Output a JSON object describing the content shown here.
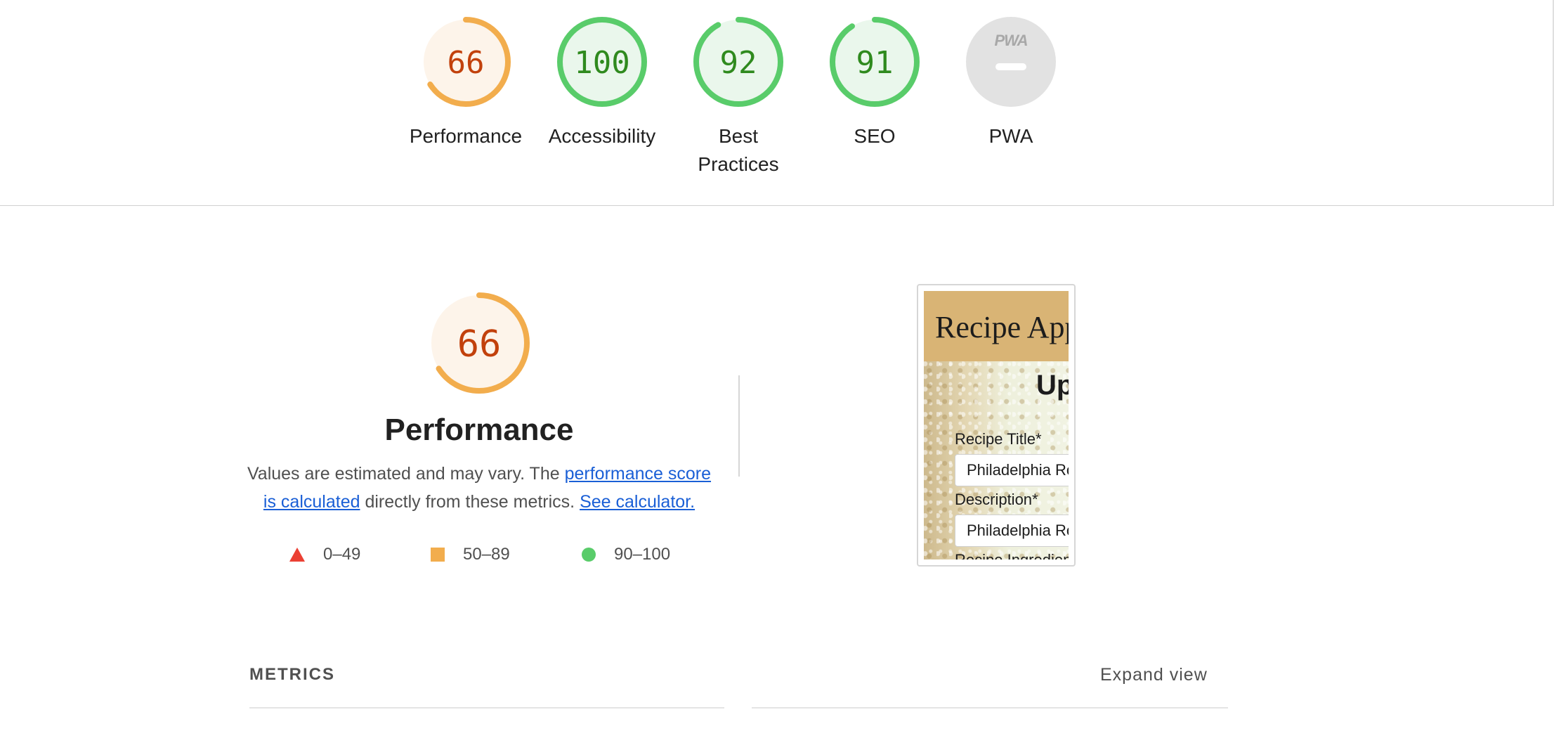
{
  "colors": {
    "average_stroke": "#f2ad4d",
    "average_fill": "#fdf4ea",
    "average_text": "#c2410c",
    "pass_stroke": "#59cc6a",
    "pass_fill": "#eaf7ec",
    "pass_text": "#2f8a1e",
    "pwa_fill": "#e2e2e2"
  },
  "gauges": [
    {
      "label": "Performance",
      "score": 66,
      "rating": "average"
    },
    {
      "label": "Accessibility",
      "score": 100,
      "rating": "pass"
    },
    {
      "label": "Best Practices",
      "score": 92,
      "rating": "pass"
    },
    {
      "label": "SEO",
      "score": 91,
      "rating": "pass"
    },
    {
      "label": "PWA",
      "score": null,
      "rating": "na",
      "badge": "PWA"
    }
  ],
  "performance": {
    "score": "66",
    "title": "Performance",
    "desc_before": "Values are estimated and may vary. The ",
    "desc_link1": "performance score is calculated",
    "desc_middle": " directly from these metrics. ",
    "desc_link2": "See calculator."
  },
  "legend": [
    {
      "shape": "triangle",
      "range": "0–49"
    },
    {
      "shape": "square",
      "range": "50–89"
    },
    {
      "shape": "circle",
      "range": "90–100"
    }
  ],
  "screenshot": {
    "app_title": "Recipe App",
    "heading": "Update",
    "field1_label": "Recipe Title*",
    "field1_value": "Philadelphia Roll",
    "field2_label": "Description*",
    "field2_value": "Philadelphia Roll",
    "field3_label": "Recipe Ingredients"
  },
  "metrics": {
    "title": "METRICS",
    "expand_label": "Expand view"
  }
}
